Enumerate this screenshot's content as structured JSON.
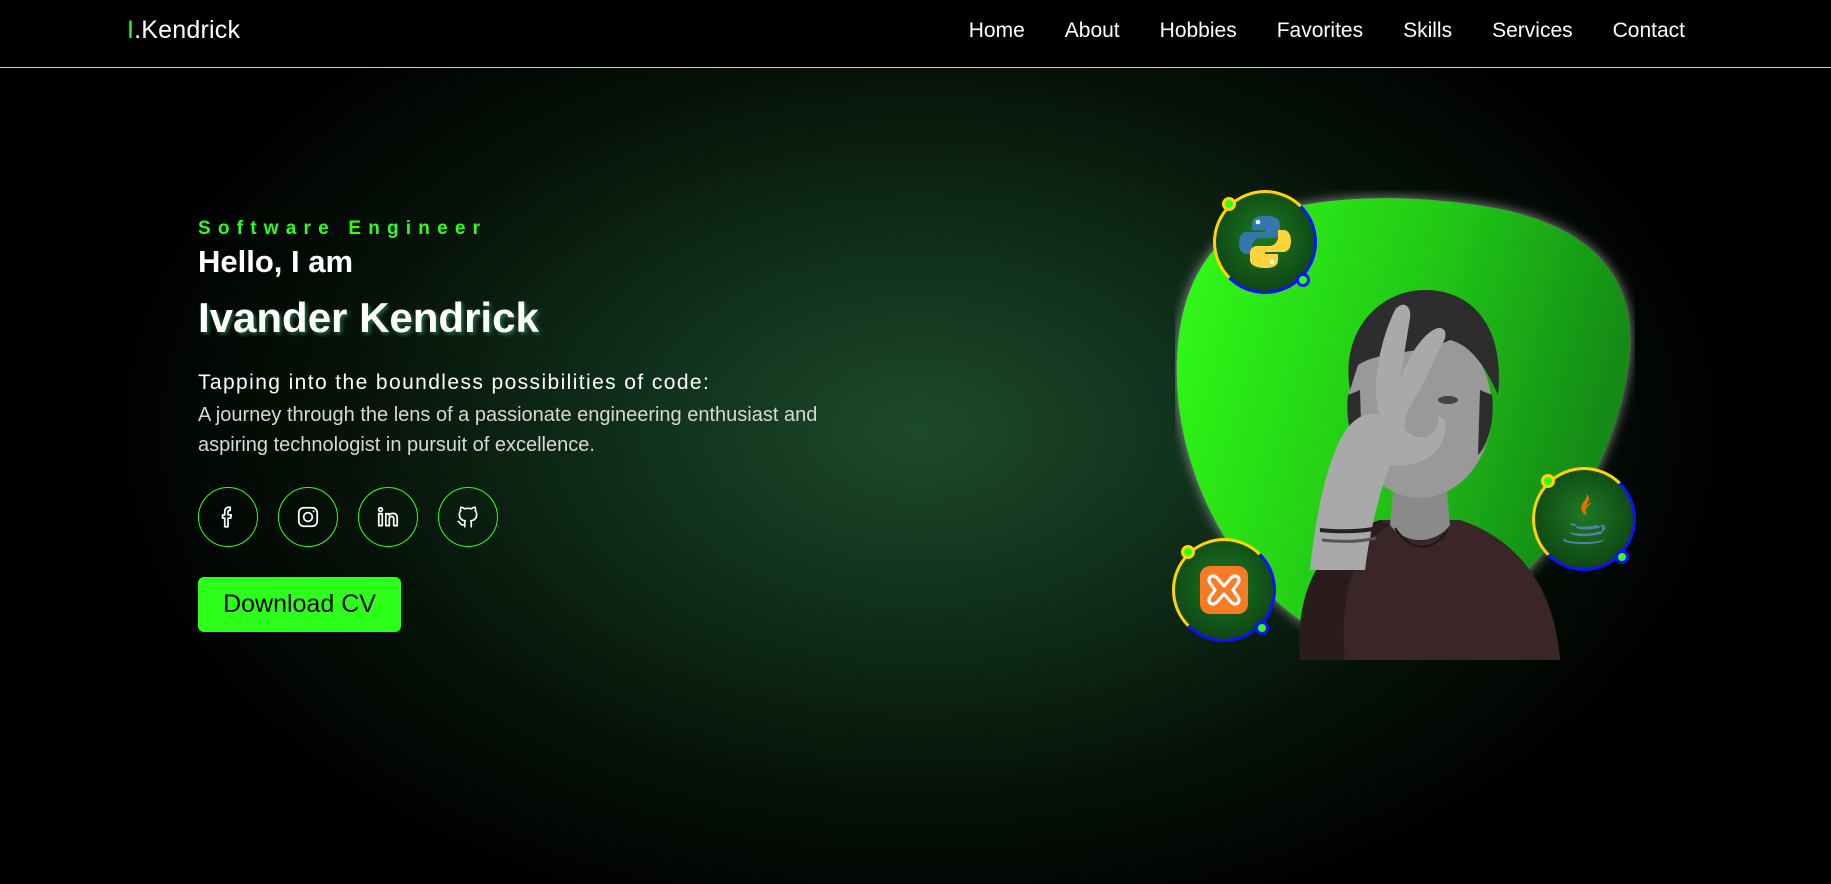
{
  "logo": {
    "accent": "I",
    "text": ".Kendrick"
  },
  "nav": {
    "items": [
      {
        "label": "Home"
      },
      {
        "label": "About"
      },
      {
        "label": "Hobbies"
      },
      {
        "label": "Favorites"
      },
      {
        "label": "Skills"
      },
      {
        "label": "Services"
      },
      {
        "label": "Contact"
      }
    ]
  },
  "hero": {
    "subtitle": "Software Engineer",
    "greeting": "Hello, I am",
    "name": "Ivander Kendrick",
    "tagline": "Tapping into the boundless possibilities of code:",
    "description": "A journey through the lens of a passionate engineering enthusiast and aspiring technologist in pursuit of excellence.",
    "cta_label": "Download CV"
  },
  "socials": [
    {
      "icon": "facebook-icon"
    },
    {
      "icon": "instagram-icon"
    },
    {
      "icon": "linkedin-icon"
    },
    {
      "icon": "github-icon"
    }
  ],
  "badges": [
    {
      "icon": "python-icon"
    },
    {
      "icon": "java-icon"
    },
    {
      "icon": "xampp-icon"
    }
  ],
  "colors": {
    "accent": "#2bff1a",
    "background": "#000000",
    "badge_ring_yellow": "#ffd400",
    "badge_ring_blue": "#1010ff"
  }
}
